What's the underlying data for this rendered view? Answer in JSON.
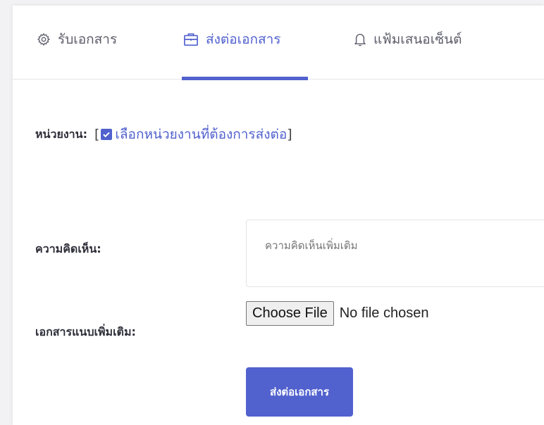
{
  "tabs": [
    {
      "label": "รับเอกสาร",
      "icon": "gear-icon",
      "active": false
    },
    {
      "label": "ส่งต่อเอกสาร",
      "icon": "briefcase-icon",
      "active": true
    },
    {
      "label": "แฟ้มเสนอเซ็นต์",
      "icon": "bell-icon",
      "active": false
    }
  ],
  "department": {
    "label": "หน่วยงาน:",
    "bracket_open": "[",
    "bracket_close": "]",
    "select_text": "เลือกหน่วยงานที่ต้องการส่งต่อ",
    "checked": true
  },
  "comment": {
    "label": "ความคิดเห็น:",
    "placeholder": "ความคิดเห็นเพิ่มเติม"
  },
  "attachment": {
    "label": "เอกสารแนบเพิ่มเติม:",
    "button_label": "Choose File",
    "status": "No file chosen"
  },
  "submit": {
    "label": "ส่งต่อเอกสาร"
  },
  "colors": {
    "accent": "#5161ce",
    "text": "#2f2f3a",
    "muted": "#5d5d6b"
  }
}
